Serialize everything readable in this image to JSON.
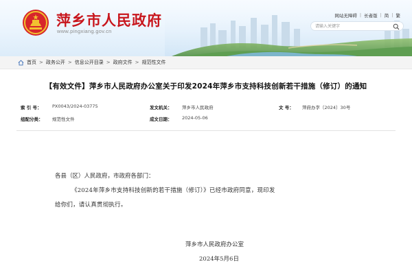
{
  "header": {
    "site_title": "萍乡市人民政府",
    "site_domain": "www.pingxiang.gov.cn",
    "top_links": [
      "网站无障碍",
      "长者版",
      "简",
      "繁"
    ],
    "search_placeholder": "请输入关键字"
  },
  "breadcrumb": [
    "首页",
    "政务公开",
    "信息公开目录",
    "政府文件",
    "规范性文件"
  ],
  "document": {
    "title": "【有效文件】萍乡市人民政府办公室关于印发2024年萍乡市支持科技创新若干措施（修订）的通知",
    "meta": {
      "index_label": "索 引 号：",
      "index_value": "PX0043/2024-03775",
      "issuer_label": "发文机关：",
      "issuer_value": "萍乡市人民政府",
      "docno_label": "文  号：",
      "docno_value": "萍府办字〔2024〕30号",
      "category_label": "组配分类：",
      "category_value": "规范性文件",
      "date_label": "成文日期：",
      "date_value": "2024-05-06"
    },
    "salutation": "各县（区）人民政府，市政府各部门：",
    "paragraph_line1": "《2024年萍乡市支持科技创新的若干措施（修订）》已经市政府同意，现印发",
    "paragraph_line2": "给你们，请认真贯彻执行。",
    "signature_org": "萍乡市人民政府办公室",
    "signature_date": "2024年5月6日"
  },
  "colors": {
    "brand_red": "#c8161d",
    "emblem_gold": "#f2c230"
  },
  "icons": {
    "home": "home-icon",
    "search": "search-icon",
    "emblem": "national-emblem-icon"
  }
}
